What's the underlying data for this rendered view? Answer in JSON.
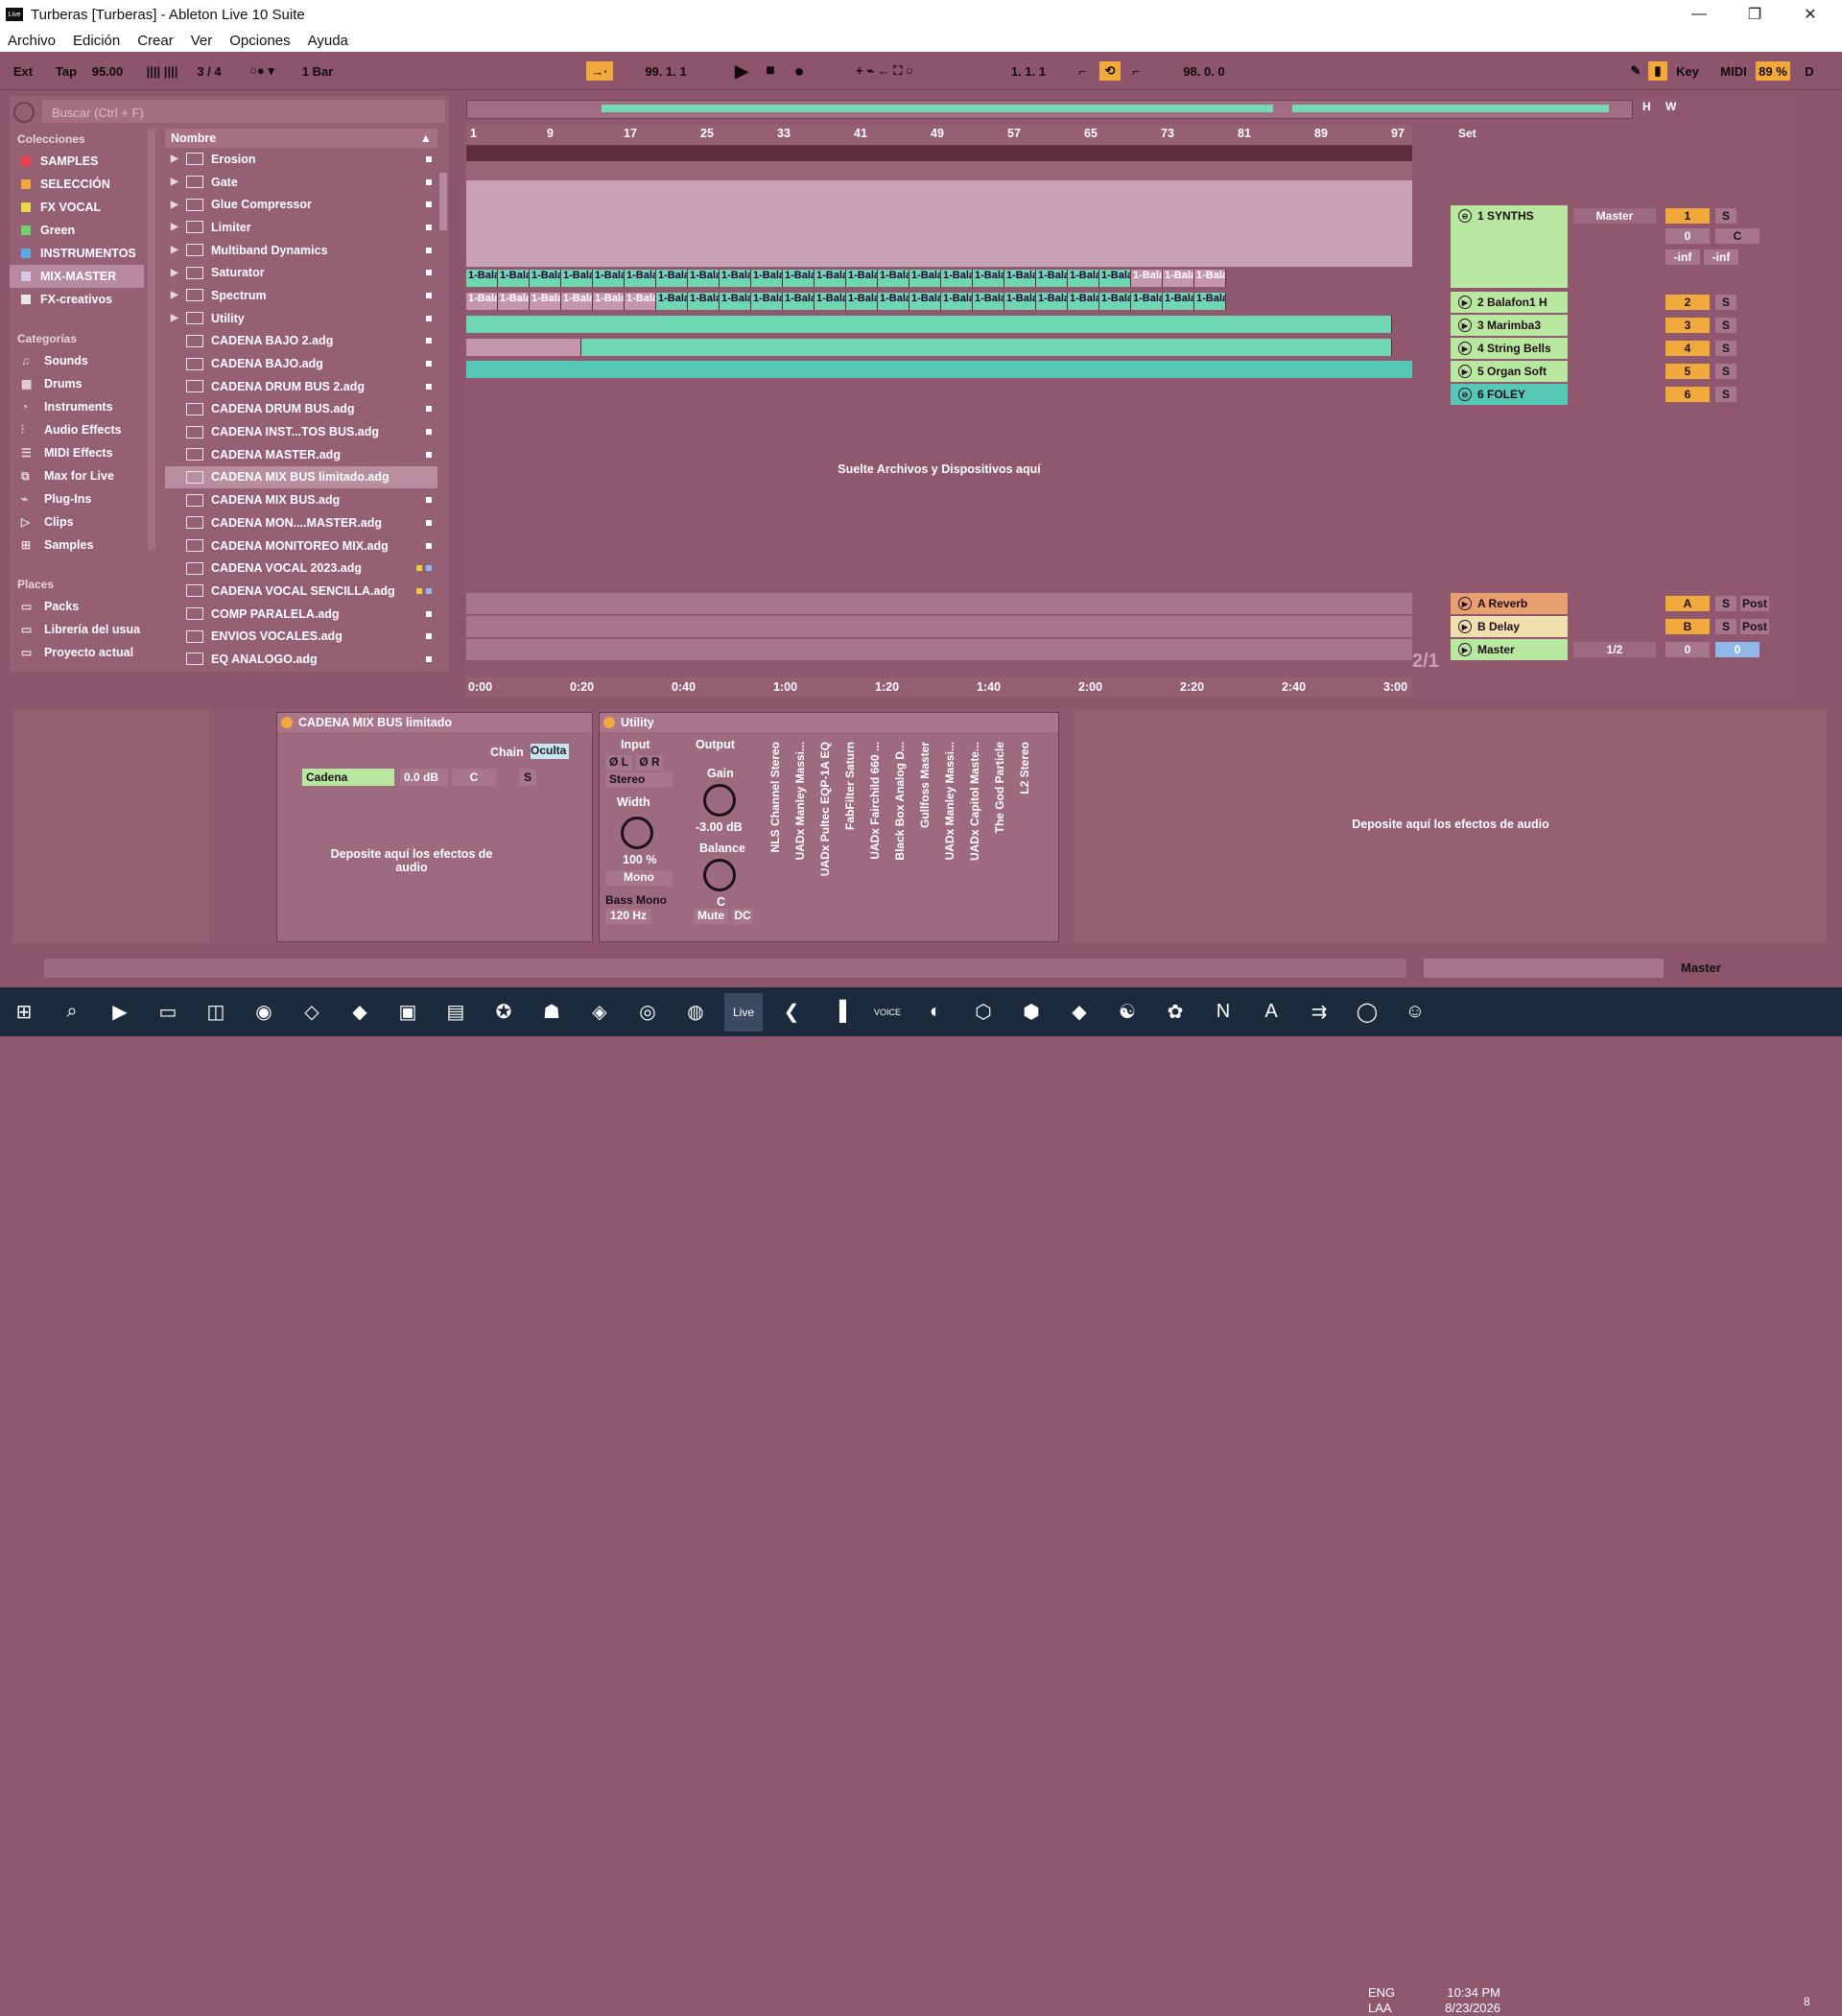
{
  "window": {
    "title": "Turberas  [Turberas] - Ableton Live 10 Suite",
    "logo": "Live"
  },
  "menu": [
    "Archivo",
    "Edición",
    "Crear",
    "Ver",
    "Opciones",
    "Ayuda"
  ],
  "transport": {
    "ext": "Ext",
    "tap": "Tap",
    "tempo": "95.00",
    "signature": "3 / 4",
    "quantize": "1 Bar",
    "position": "99.  1.  1",
    "loop_start": "1.  1.  1",
    "loop_length": "98.  0.  0",
    "key": "Key",
    "midi": "MIDI",
    "cpu": "89 %",
    "d": "D"
  },
  "browser": {
    "search_placeholder": "Buscar (Ctrl + F)",
    "collections_title": "Colecciones",
    "collections": [
      {
        "label": "SAMPLES",
        "color": "#e8434f"
      },
      {
        "label": "SELECCIÓN",
        "color": "#f0a93a"
      },
      {
        "label": "FX VOCAL",
        "color": "#e8d94a"
      },
      {
        "label": "Green",
        "color": "#6ed36b"
      },
      {
        "label": "INSTRUMENTOS",
        "color": "#5aa8e0"
      },
      {
        "label": "MIX-MASTER",
        "color": "#d7c8e8"
      },
      {
        "label": "FX-creativos",
        "color": "#e8e8e8"
      }
    ],
    "categories_title": "Categorías",
    "categories": [
      "Sounds",
      "Drums",
      "Instruments",
      "Audio Effects",
      "MIDI Effects",
      "Max for Live",
      "Plug-Ins",
      "Clips",
      "Samples"
    ],
    "places_title": "Places",
    "places": [
      "Packs",
      "Librería del usua",
      "Proyecto actual"
    ],
    "files_header": "Nombre",
    "folders": [
      "Erosion",
      "Gate",
      "Glue Compressor",
      "Limiter",
      "Multiband Dynamics",
      "Saturator",
      "Spectrum",
      "Utility"
    ],
    "files": [
      "CADENA BAJO 2.adg",
      "CADENA BAJO.adg",
      "CADENA DRUM BUS 2.adg",
      "CADENA DRUM BUS.adg",
      "CADENA INST...TOS BUS.adg",
      "CADENA MASTER.adg",
      "CADENA MIX BUS limitado.adg",
      "CADENA MIX BUS.adg",
      "CADENA MON....MASTER.adg",
      "CADENA MONITOREO MIX.adg",
      "CADENA VOCAL 2023.adg",
      "CADENA VOCAL SENCILLA.adg",
      "COMP PARALELA.adg",
      "ENVIOS VOCALES.adg",
      "EQ ANALOGO.adg"
    ]
  },
  "arrangement": {
    "bars": [
      "1",
      "9",
      "17",
      "25",
      "33",
      "41",
      "49",
      "57",
      "65",
      "73",
      "81",
      "89",
      "97"
    ],
    "times": [
      "0:00",
      "0:20",
      "0:40",
      "1:00",
      "1:20",
      "1:40",
      "2:00",
      "2:20",
      "2:40",
      "3:00"
    ],
    "clip_label": "1-Bala",
    "drop_hint": "Suelte Archivos y Dispositivos aquí",
    "set_label": "Set",
    "overview_h": "H",
    "overview_w": "W",
    "fraction": "2/1"
  },
  "tracks": [
    {
      "name": "1 SYNTHS",
      "route": "Master",
      "num": "1",
      "solo": "S",
      "color": "#b8e8a0",
      "vol": "0",
      "pan": "C",
      "inf1": "-inf",
      "inf2": "-inf"
    },
    {
      "name": "2 Balafon1 H",
      "num": "2",
      "solo": "S",
      "color": "#b8e8a0"
    },
    {
      "name": "3 Marimba3",
      "num": "3",
      "solo": "S",
      "color": "#b8e8a0"
    },
    {
      "name": "4 String Bells",
      "num": "4",
      "solo": "S",
      "color": "#b8e8a0"
    },
    {
      "name": "5 Organ Soft",
      "num": "5",
      "solo": "S",
      "color": "#b8e8a0"
    },
    {
      "name": "6 FOLEY",
      "num": "6",
      "solo": "S",
      "color": "#56c8b8"
    },
    {
      "name": "A Reverb",
      "num": "A",
      "solo": "S",
      "post": "Post",
      "color": "#e8a070"
    },
    {
      "name": "B Delay",
      "num": "B",
      "solo": "S",
      "post": "Post",
      "color": "#f0e0b0"
    },
    {
      "name": "Master",
      "route": "1/2",
      "vol": "0",
      "vol2": "0",
      "color": "#b8e8a0"
    }
  ],
  "devices": {
    "rack_title": "CADENA MIX BUS limitado",
    "chain_label": "Chain",
    "chain_mode": "Oculta",
    "chain_name": "Cadena",
    "chain_vol": "0.0 dB",
    "chain_pan": "C",
    "chain_solo": "S",
    "rack_drop": "Deposite aquí los efectos de audio",
    "utility_title": "Utility",
    "input": "Input",
    "output": "Output",
    "phase_l": "Ø L",
    "phase_r": "Ø R",
    "stereo": "Stereo",
    "width": "Width",
    "width_val": "100 %",
    "mono": "Mono",
    "gain": "Gain",
    "gain_val": "-3.00 dB",
    "balance": "Balance",
    "balance_val": "C",
    "bass_mono": "Bass Mono",
    "bass_freq": "120 Hz",
    "mute": "Mute",
    "dc": "DC",
    "plugins": [
      "NLS Channel Stereo",
      "UADx Manley Massi...",
      "UADx Pultec EQP-1A EQ",
      "FabFilter Saturn",
      "UADx Fairchild 660 ...",
      "Black Box Analog D...",
      "Gullfoss Master",
      "UADx Manley Massi...",
      "UADx Capitol Maste...",
      "The God Particle",
      "L2 Stereo"
    ],
    "right_drop": "Deposite aquí los efectos de audio"
  },
  "status": {
    "master": "Master"
  },
  "taskbar": {
    "lang1": "ENG",
    "lang2": "LAA",
    "time": "10:34 PM",
    "date": "8/23/2026",
    "notif": "8"
  }
}
